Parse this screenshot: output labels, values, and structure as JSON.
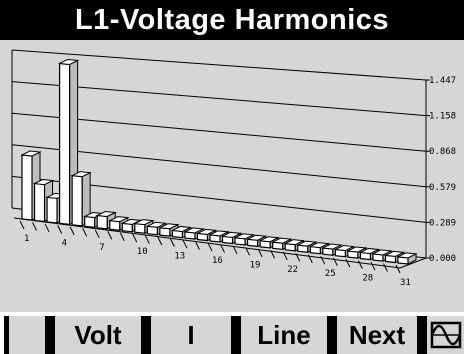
{
  "screen": {
    "title": "L1-Voltage Harmonics"
  },
  "chart_data": {
    "type": "bar",
    "style": "3d-bar-spectrum",
    "y_ticks": [
      "1.447",
      "1.158",
      "0.868",
      "0.579",
      "0.289",
      "0.000"
    ],
    "ylim": [
      0,
      1.447
    ],
    "x_tick_labels": [
      "1",
      "4",
      "7",
      "10",
      "13",
      "16",
      "19",
      "22",
      "25",
      "28",
      "31"
    ],
    "categories": [
      "1",
      "2",
      "3",
      "4",
      "5",
      "6",
      "7",
      "8",
      "9",
      "10",
      "11",
      "12",
      "13",
      "14",
      "15",
      "16",
      "17",
      "18",
      "19",
      "20",
      "21",
      "22",
      "23",
      "24",
      "25",
      "26",
      "27",
      "28",
      "29",
      "30",
      "31"
    ],
    "values": [
      0.52,
      0.3,
      0.2,
      1.3,
      0.4,
      0.08,
      0.1,
      0.07,
      0.06,
      0.07,
      0.06,
      0.06,
      0.05,
      0.05,
      0.05,
      0.05,
      0.05,
      0.05,
      0.05,
      0.05,
      0.05,
      0.05,
      0.05,
      0.05,
      0.05,
      0.05,
      0.05,
      0.05,
      0.05,
      0.05,
      0.05
    ],
    "grid": true,
    "colors": {
      "bar_face": "#ffffff",
      "bar_side": "#bdbdbd",
      "line": "#000000",
      "background": "#d6d6d6"
    }
  },
  "softkeys": [
    {
      "id": "blank",
      "label": ""
    },
    {
      "id": "volt",
      "label": "Volt"
    },
    {
      "id": "i",
      "label": "I"
    },
    {
      "id": "line",
      "label": "Line"
    },
    {
      "id": "next",
      "label": "Next"
    },
    {
      "id": "waveform",
      "label": "",
      "icon": "waveform-icon"
    }
  ]
}
